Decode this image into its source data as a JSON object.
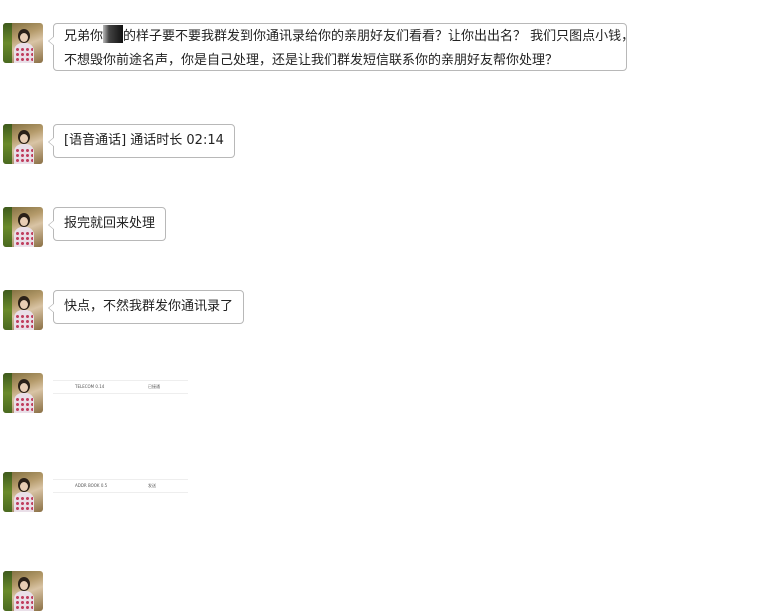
{
  "messages": [
    {
      "type": "text",
      "line1_part1": "兄弟你",
      "line1_part2": "的样子要不要我群发到你通讯录给你的亲朋好友们看看？让你出出名？ 我们只图点小钱，",
      "line2": "不想毁你前途名声，你是自己处理，还是让我们群发短信联系你的亲朋好友帮你处理？"
    },
    {
      "type": "text",
      "text": "[语音通话] 通话时长 02:14"
    },
    {
      "type": "text",
      "text": "报完就回来处理"
    },
    {
      "type": "text",
      "text": "快点，不然我群发你通讯录了"
    },
    {
      "type": "thumbnail",
      "left": "TELECOM 0.14",
      "right": "已接通"
    },
    {
      "type": "thumbnail",
      "left": "ADDR BOOK 0.5",
      "right": "发送"
    }
  ]
}
